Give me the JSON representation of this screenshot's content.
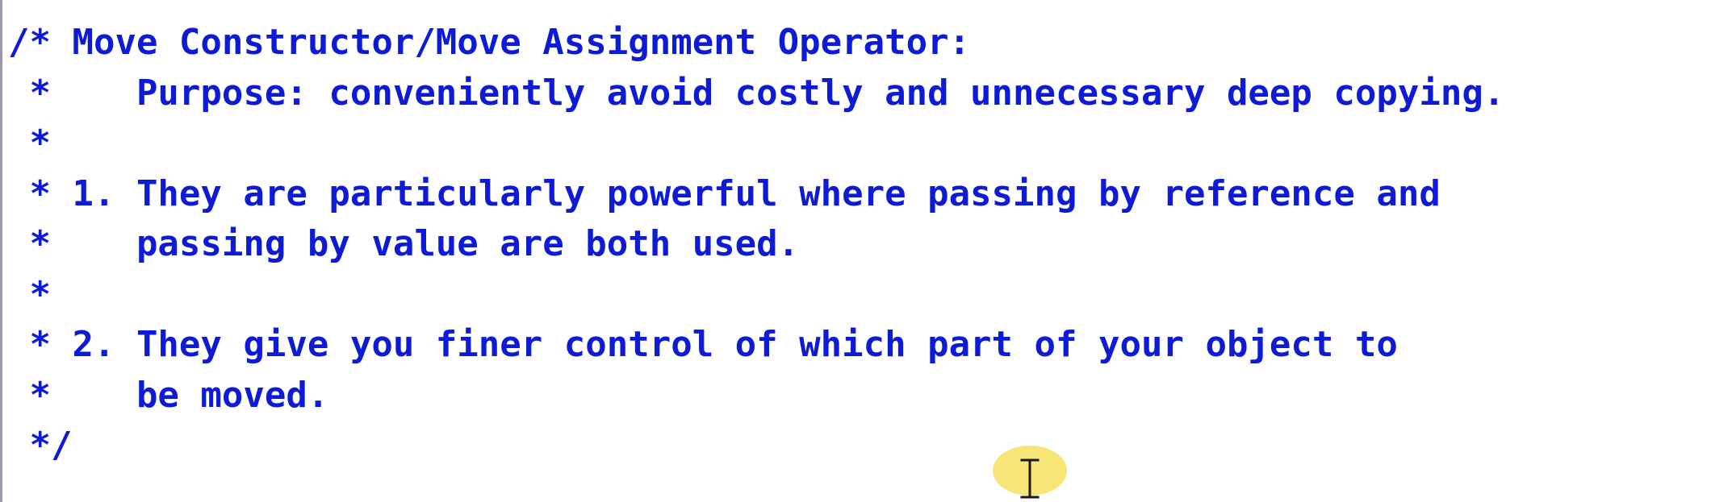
{
  "code_lines": [
    "/* Move Constructor/Move Assignment Operator:",
    " *    Purpose: conveniently avoid costly and unnecessary deep copying.",
    " *",
    " * 1. They are particularly powerful where passing by reference and",
    " *    passing by value are both used.",
    " *",
    " * 2. They give you finer control of which part of your object to",
    " *    be moved.",
    " */"
  ],
  "colors": {
    "comment_text": "#0d1ad6",
    "background": "#ffffff",
    "cursor_highlight": "#f6e060"
  },
  "icons": {
    "cursor": "text-cursor-icon"
  }
}
